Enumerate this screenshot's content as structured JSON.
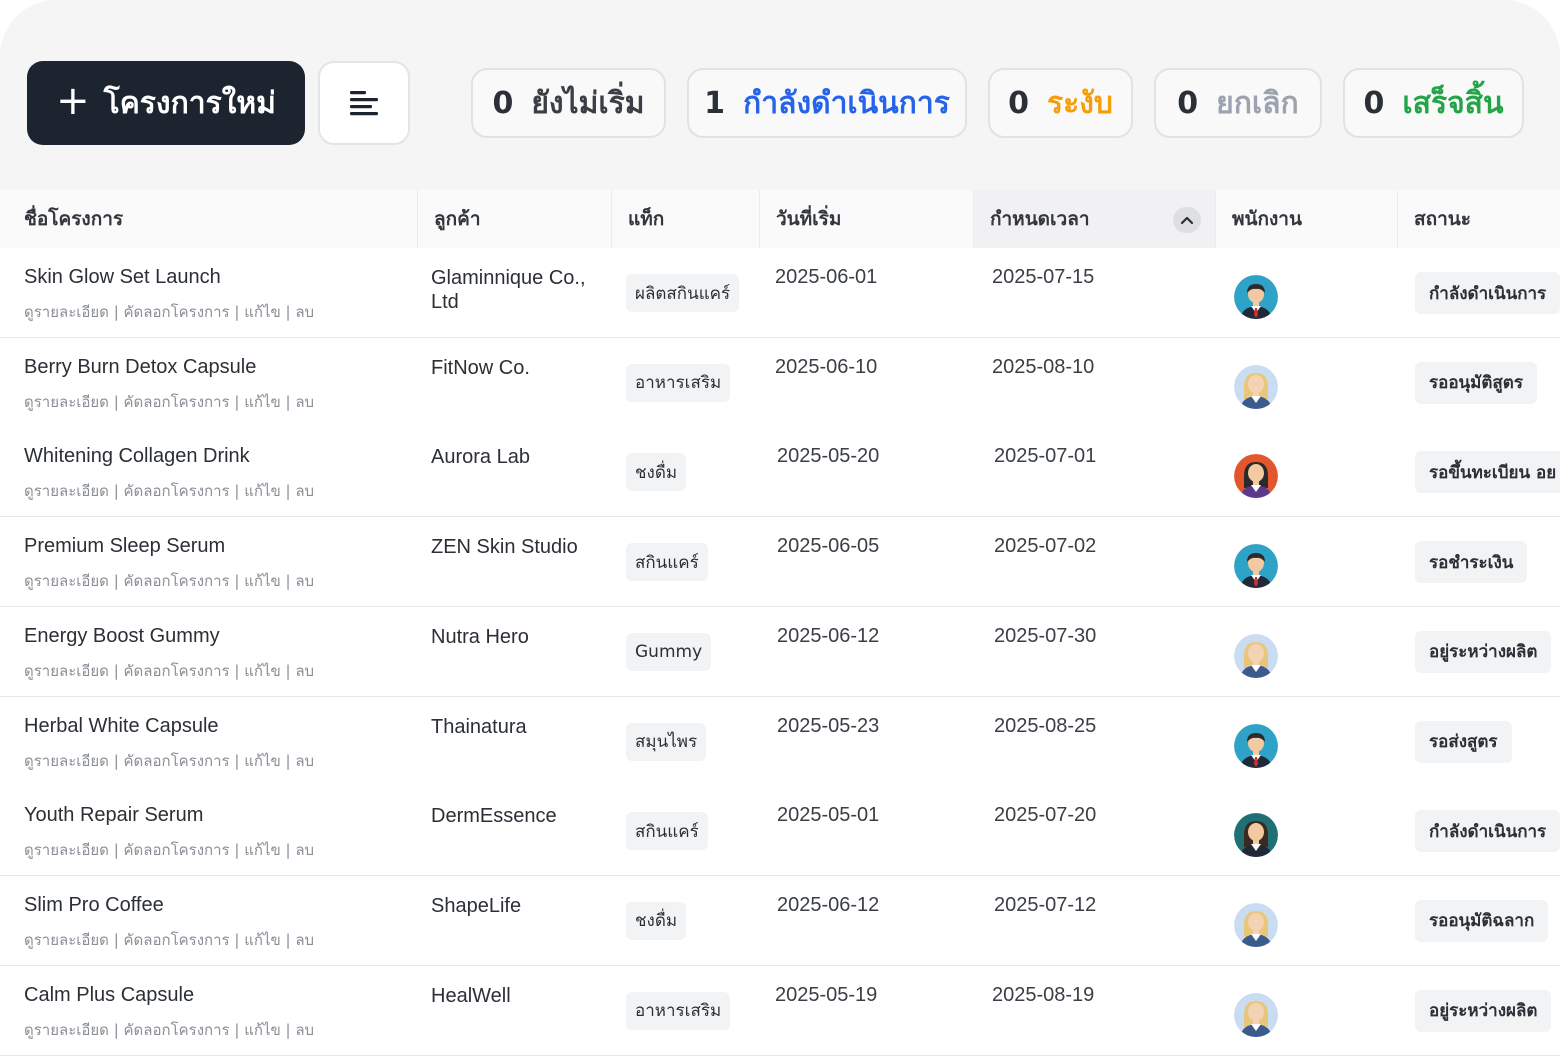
{
  "toolbar": {
    "new_project_label": "โครงการใหม่",
    "plus_icon": "+"
  },
  "stats": [
    {
      "count": "0",
      "label": "ยังไม่เริ่ม",
      "color": "#3a3e45"
    },
    {
      "count": "1",
      "label": "กำลังดำเนินการ",
      "color": "#2563eb"
    },
    {
      "count": "0",
      "label": "ระงับ",
      "color": "#f59e0b"
    },
    {
      "count": "0",
      "label": "ยกเลิก",
      "color": "#9ca3af"
    },
    {
      "count": "0",
      "label": "เสร็จสิ้น",
      "color": "#22a447"
    }
  ],
  "table": {
    "columns": [
      "ชื่อโครงการ",
      "ลูกค้า",
      "แท็ก",
      "วันที่เริ่ม",
      "กำหนดเวลา",
      "พนักงาน",
      "สถานะ"
    ],
    "sorted_column": "กำหนดเวลา",
    "actions_text": "ดูรายละเอียด | คัดลอกโครงการ | แก้ไข | ลบ",
    "rows": [
      {
        "name": "Skin Glow Set Launch",
        "client": "Glaminnique Co., Ltd",
        "tag": "ผลิตสกินแคร์",
        "start": "2025-06-01",
        "deadline": "2025-07-15",
        "avatar": "male-teal",
        "status": "กำลังดำเนินการ"
      },
      {
        "name": "Berry Burn Detox Capsule",
        "client": "FitNow Co.",
        "tag": "อาหารเสริม",
        "start": "2025-06-10",
        "deadline": "2025-08-10",
        "avatar": "female-light",
        "status": "รออนุมัติสูตร"
      },
      {
        "name": "Whitening Collagen Drink",
        "client": "Aurora Lab",
        "tag": "ชงดื่ม",
        "start": "2025-05-20",
        "deadline": "2025-07-01",
        "avatar": "female-red",
        "status": "รอขึ้นทะเบียน อย"
      },
      {
        "name": "Premium Sleep Serum",
        "client": "ZEN Skin Studio",
        "tag": "สกินแคร์",
        "start": "2025-06-05",
        "deadline": "2025-07-02",
        "avatar": "male-teal",
        "status": "รอชำระเงิน"
      },
      {
        "name": "Energy Boost Gummy",
        "client": "Nutra Hero",
        "tag": "Gummy",
        "start": "2025-06-12",
        "deadline": "2025-07-30",
        "avatar": "female-light",
        "status": "อยู่ระหว่างผลิต"
      },
      {
        "name": "Herbal White Capsule",
        "client": "Thainatura",
        "tag": "สมุนไพร",
        "start": "2025-05-23",
        "deadline": "2025-08-25",
        "avatar": "male-teal",
        "status": "รอส่งสูตร"
      },
      {
        "name": "Youth Repair Serum",
        "client": "DermEssence",
        "tag": "สกินแคร์",
        "start": "2025-05-01",
        "deadline": "2025-07-20",
        "avatar": "female-dark",
        "status": "กำลังดำเนินการ"
      },
      {
        "name": "Slim Pro Coffee",
        "client": "ShapeLife",
        "tag": "ชงดื่ม",
        "start": "2025-06-12",
        "deadline": "2025-07-12",
        "avatar": "female-light",
        "status": "รออนุมัติฉลาก"
      },
      {
        "name": "Calm Plus Capsule",
        "client": "HealWell",
        "tag": "อาหารเสริม",
        "start": "2025-05-19",
        "deadline": "2025-08-19",
        "avatar": "female-light",
        "status": "อยู่ระหว่างผลิต"
      }
    ]
  }
}
